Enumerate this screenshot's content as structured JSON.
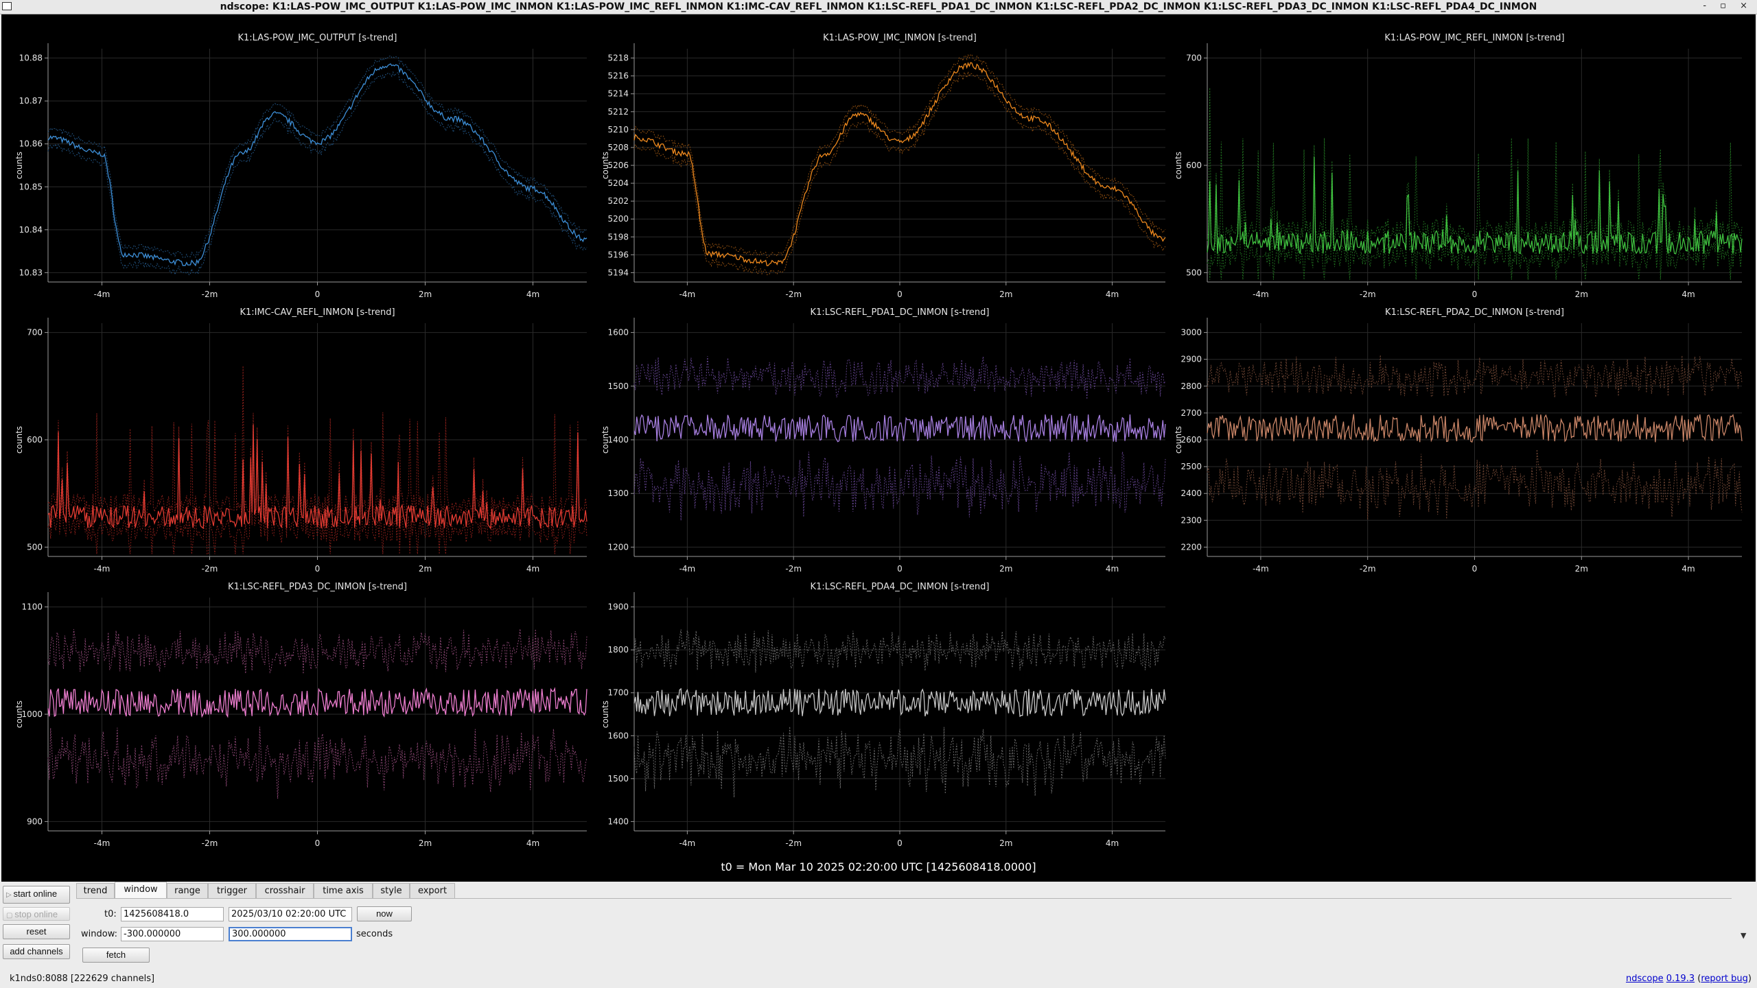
{
  "window": {
    "title": "ndscope: K1:LAS-POW_IMC_OUTPUT K1:LAS-POW_IMC_INMON K1:LAS-POW_IMC_REFL_INMON K1:IMC-CAV_REFL_INMON K1:LSC-REFL_PDA1_DC_INMON K1:LSC-REFL_PDA2_DC_INMON K1:LSC-REFL_PDA3_DC_INMON K1:LSC-REFL_PDA4_DC_INMON",
    "controls": "- ▫ ×"
  },
  "plots": [
    {
      "title": "K1:LAS-POW_IMC_OUTPUT [s-trend]",
      "ylabel": "counts",
      "color": "#3d8fd8",
      "dim": "#1f4e7a",
      "kind": "trend",
      "y_ticks": [
        "10.83",
        "10.84",
        "10.85",
        "10.86",
        "10.87",
        "10.88"
      ],
      "x_ticks": [
        "-4m",
        "-2m",
        "0",
        "2m",
        "4m"
      ]
    },
    {
      "title": "K1:LAS-POW_IMC_INMON [s-trend]",
      "ylabel": "counts",
      "color": "#f08a1e",
      "dim": "#8a4c10",
      "kind": "trend",
      "y_ticks": [
        "5194",
        "5196",
        "5198",
        "5200",
        "5202",
        "5204",
        "5206",
        "5208",
        "5210",
        "5212",
        "5214",
        "5216",
        "5218"
      ],
      "x_ticks": [
        "-4m",
        "-2m",
        "0",
        "2m",
        "4m"
      ]
    },
    {
      "title": "K1:LAS-POW_IMC_REFL_INMON [s-trend]",
      "ylabel": "counts",
      "color": "#3fbf3f",
      "dim": "#1f6d1f",
      "kind": "spiky",
      "y_ticks": [
        "500",
        "600",
        "700"
      ],
      "x_ticks": [
        "-4m",
        "-2m",
        "0",
        "2m",
        "4m"
      ]
    },
    {
      "title": "K1:IMC-CAV_REFL_INMON [s-trend]",
      "ylabel": "counts",
      "color": "#e23b32",
      "dim": "#861e19",
      "kind": "spiky",
      "y_ticks": [
        "500",
        "600",
        "700"
      ],
      "x_ticks": [
        "-4m",
        "-2m",
        "0",
        "2m",
        "4m"
      ]
    },
    {
      "title": "K1:LSC-REFL_PDA1_DC_INMON [s-trend]",
      "ylabel": "counts",
      "color": "#a77fe0",
      "dim": "#5d3f86",
      "kind": "noise",
      "y_ticks": [
        "1200",
        "1300",
        "1400",
        "1500",
        "1600"
      ],
      "x_ticks": [
        "-4m",
        "-2m",
        "0",
        "2m",
        "4m"
      ]
    },
    {
      "title": "K1:LSC-REFL_PDA2_DC_INMON [s-trend]",
      "ylabel": "counts",
      "color": "#c98567",
      "dim": "#6e4533",
      "kind": "noise",
      "y_ticks": [
        "2200",
        "2300",
        "2400",
        "2500",
        "2600",
        "2700",
        "2800",
        "2900",
        "3000"
      ],
      "x_ticks": [
        "-4m",
        "-2m",
        "0",
        "2m",
        "4m"
      ]
    },
    {
      "title": "K1:LSC-REFL_PDA3_DC_INMON [s-trend]",
      "ylabel": "counts",
      "color": "#ee7ed0",
      "dim": "#874470",
      "kind": "noise",
      "y_ticks": [
        "900",
        "1000",
        "1100"
      ],
      "x_ticks": [
        "-4m",
        "-2m",
        "0",
        "2m",
        "4m"
      ]
    },
    {
      "title": "K1:LSC-REFL_PDA4_DC_INMON [s-trend]",
      "ylabel": "counts",
      "color": "#c8c8c8",
      "dim": "#6a6a6a",
      "kind": "noise",
      "y_ticks": [
        "1400",
        "1500",
        "1600",
        "1700",
        "1800",
        "1900"
      ],
      "x_ticks": [
        "-4m",
        "-2m",
        "0",
        "2m",
        "4m"
      ]
    }
  ],
  "t0_text": "t0 = Mon Mar 10 2025 02:20:00 UTC [1425608418.0000]",
  "controls": {
    "start_online": "start online",
    "stop_online": "stop online",
    "reset": "reset",
    "add_channels": "add channels",
    "tabs": [
      "trend",
      "window",
      "range",
      "trigger",
      "crosshair",
      "time axis",
      "style",
      "export"
    ],
    "active_tab": "window",
    "t0_label": "t0:",
    "t0_gps": "1425608418.0",
    "t0_utc": "2025/03/10 02:20:00 UTC",
    "now": "now",
    "window_label": "window:",
    "window_start": "-300.000000",
    "window_end": "300.000000",
    "seconds": "seconds",
    "fetch": "fetch",
    "collapse_arrow": "▼"
  },
  "status": {
    "server": "k1nds0:8088  [222629 channels]",
    "app": "ndscope",
    "version": "0.19.3",
    "report_bug": "report bug",
    "paren_open": "(",
    "paren_close": ")"
  }
}
